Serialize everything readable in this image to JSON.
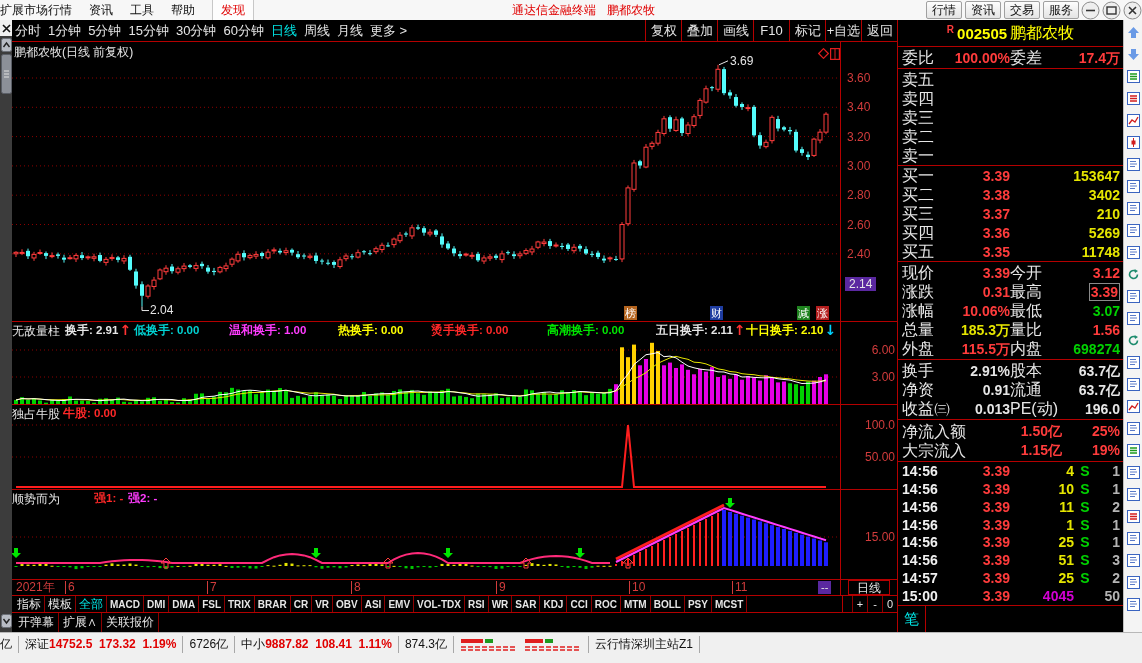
{
  "menu_bar": {
    "items": [
      {
        "label": "扩展市场行情",
        "highlighted": false
      },
      {
        "label": "资讯",
        "highlighted": false
      },
      {
        "label": "工具",
        "highlighted": false
      },
      {
        "label": "帮助",
        "highlighted": false
      },
      {
        "label": "发现",
        "highlighted": true
      }
    ],
    "title": "通达信金融终端",
    "security": "鹏都农牧",
    "buttons": [
      "行情",
      "资讯",
      "交易",
      "服务"
    ]
  },
  "period_tabs": [
    {
      "label": "分时",
      "selected": false
    },
    {
      "label": "1分钟",
      "selected": false
    },
    {
      "label": "5分钟",
      "selected": false
    },
    {
      "label": "15分钟",
      "selected": false
    },
    {
      "label": "30分钟",
      "selected": false
    },
    {
      "label": "60分钟",
      "selected": false
    },
    {
      "label": "日线",
      "selected": true
    },
    {
      "label": "周线",
      "selected": false
    },
    {
      "label": "月线",
      "selected": false
    },
    {
      "label": "更多 >",
      "selected": false
    }
  ],
  "chart_buttons": [
    "复权",
    "叠加",
    "画线",
    "F10",
    "标记",
    "+自选",
    "返回"
  ],
  "main_chart": {
    "title": "鹏都农牧(日线 前复权)",
    "price_axis": [
      "3.60",
      "3.40",
      "3.20",
      "3.00",
      "2.80",
      "2.60",
      "2.40"
    ],
    "cursor_price": "2.14",
    "high_label": "3.69",
    "low_label": "2.04",
    "event_markers": [
      {
        "label": "榜",
        "color": "#b4641e"
      },
      {
        "label": "财",
        "color": "#1e3ca0"
      },
      {
        "label": "减",
        "color": "#1e821e"
      },
      {
        "label": "涨",
        "color": "#b41e1e"
      }
    ]
  },
  "indicators": [
    {
      "name": "无敌量柱",
      "kind": "volume",
      "fields": [
        {
          "text": "换手: 2.91",
          "color": "#e6e6e6",
          "arrow": {
            "text": "↑",
            "color": "#ff3232"
          }
        },
        {
          "text": "低换手: 0.00",
          "color": "#00d2d2"
        },
        {
          "text": "温和换手: 1.00",
          "color": "#ff3cff"
        },
        {
          "text": "热换手: 0.00",
          "color": "#ffff00"
        },
        {
          "text": "烫手换手: 0.00",
          "color": "#ff2828"
        },
        {
          "text": "高潮换手: 0.00",
          "color": "#00e600"
        },
        {
          "text": "五日换手: 2.11",
          "color": "#e6e6e6",
          "arrow": {
            "text": "↑",
            "color": "#ff3232"
          }
        },
        {
          "text": "十日换手: 2.10",
          "color": "#ffff00",
          "arrow": {
            "text": "↓",
            "color": "#00d2ff"
          }
        }
      ],
      "axis": [
        "6.00",
        "3.00"
      ]
    },
    {
      "name": "独占牛股",
      "kind": "signal",
      "fields": [
        {
          "text": "牛股: 0.00",
          "color": "#ff2828"
        }
      ],
      "axis": [
        "100.0",
        "50.00"
      ]
    },
    {
      "name": "顺势而为",
      "kind": "trend",
      "fields": [
        {
          "text": "强1: -",
          "color": "#ff2828"
        },
        {
          "text": "强2: -",
          "color": "#ff3cff"
        }
      ],
      "axis": [
        "15.00"
      ]
    }
  ],
  "date_axis": {
    "year": "2021年",
    "months": [
      "6",
      "7",
      "8",
      "9",
      "10",
      "11"
    ],
    "cursor_date": "--",
    "period": "日线"
  },
  "indicator_tabs": [
    {
      "label": "指标",
      "selected": false
    },
    {
      "label": "模板",
      "selected": false
    },
    {
      "label": "全部",
      "selected": true
    },
    {
      "label": "MACD",
      "selected": false
    },
    {
      "label": "DMI",
      "selected": false
    },
    {
      "label": "DMA",
      "selected": false
    },
    {
      "label": "FSL",
      "selected": false
    },
    {
      "label": "TRIX",
      "selected": false
    },
    {
      "label": "BRAR",
      "selected": false
    },
    {
      "label": "CR",
      "selected": false
    },
    {
      "label": "VR",
      "selected": false
    },
    {
      "label": "OBV",
      "selected": false
    },
    {
      "label": "ASI",
      "selected": false
    },
    {
      "label": "EMV",
      "selected": false
    },
    {
      "label": "VOL-TDX",
      "selected": false
    },
    {
      "label": "RSI",
      "selected": false
    },
    {
      "label": "WR",
      "selected": false
    },
    {
      "label": "SAR",
      "selected": false
    },
    {
      "label": "KDJ",
      "selected": false
    },
    {
      "label": "CCI",
      "selected": false
    },
    {
      "label": "ROC",
      "selected": false
    },
    {
      "label": "MTM",
      "selected": false
    },
    {
      "label": "BOLL",
      "selected": false
    },
    {
      "label": "PSY",
      "selected": false
    },
    {
      "label": "MCST",
      "selected": false
    }
  ],
  "zoom_buttons": [
    "+",
    "-",
    "0"
  ],
  "bottom_tabs": [
    "开弹幕",
    "扩展∧",
    "关联报价"
  ],
  "quote": {
    "flag": "R",
    "code": "002505",
    "name": "鹏都农牧",
    "order_ratio": [
      {
        "label": "委比",
        "value": "100.00%"
      },
      {
        "label": "委差",
        "value": "17.4万"
      }
    ],
    "sell_levels": [
      "卖五",
      "卖四",
      "卖三",
      "卖二",
      "卖一"
    ],
    "buy_levels": [
      {
        "label": "买一",
        "price": "3.39",
        "volume": "153647"
      },
      {
        "label": "买二",
        "price": "3.38",
        "volume": "3402"
      },
      {
        "label": "买三",
        "price": "3.37",
        "volume": "210"
      },
      {
        "label": "买四",
        "price": "3.36",
        "volume": "5269"
      },
      {
        "label": "买五",
        "price": "3.35",
        "volume": "11748"
      }
    ],
    "stats": [
      [
        {
          "label": "现价",
          "value": "3.39",
          "color": "#ff3c3c",
          "boxed": false
        },
        {
          "label": "今开",
          "value": "3.12",
          "color": "#ff3c3c",
          "boxed": false
        }
      ],
      [
        {
          "label": "涨跌",
          "value": "0.31",
          "color": "#ff3c3c",
          "boxed": false
        },
        {
          "label": "最高",
          "value": "3.39",
          "color": "#ff3c3c",
          "boxed": true
        }
      ],
      [
        {
          "label": "涨幅",
          "value": "10.06%",
          "color": "#ff3c3c",
          "boxed": false
        },
        {
          "label": "最低",
          "value": "3.07",
          "color": "#00d200",
          "boxed": false
        }
      ],
      [
        {
          "label": "总量",
          "value": "185.3万",
          "color": "#e6e600",
          "boxed": false
        },
        {
          "label": "量比",
          "value": "1.56",
          "color": "#ff3c3c",
          "boxed": false
        }
      ],
      [
        {
          "label": "外盘",
          "value": "115.5万",
          "color": "#ff3c3c",
          "boxed": false
        },
        {
          "label": "内盘",
          "value": "698274",
          "color": "#00d200",
          "boxed": false
        }
      ]
    ],
    "fundamentals": [
      [
        {
          "label": "换手",
          "value": "2.91%"
        },
        {
          "label": "股本",
          "value": "63.7亿"
        }
      ],
      [
        {
          "label": "净资",
          "value": "0.91"
        },
        {
          "label": "流通",
          "value": "63.7亿"
        }
      ],
      [
        {
          "label": "收益㈢",
          "value": "0.013"
        },
        {
          "label": "PE(动)",
          "value": "196.0"
        }
      ]
    ],
    "flows": [
      {
        "label": "净流入额",
        "amount": "1.50亿",
        "ratio": "25%"
      },
      {
        "label": "大宗流入",
        "amount": "1.15亿",
        "ratio": "19%"
      }
    ],
    "ticks": [
      {
        "time": "14:56",
        "price": "3.39",
        "volume": "4",
        "side": "S",
        "count": "1",
        "color": "#e6e600"
      },
      {
        "time": "14:56",
        "price": "3.39",
        "volume": "10",
        "side": "S",
        "count": "1",
        "color": "#e6e600"
      },
      {
        "time": "14:56",
        "price": "3.39",
        "volume": "11",
        "side": "S",
        "count": "2",
        "color": "#e6e600"
      },
      {
        "time": "14:56",
        "price": "3.39",
        "volume": "1",
        "side": "S",
        "count": "1",
        "color": "#e6e600"
      },
      {
        "time": "14:56",
        "price": "3.39",
        "volume": "25",
        "side": "S",
        "count": "1",
        "color": "#e6e600"
      },
      {
        "time": "14:56",
        "price": "3.39",
        "volume": "51",
        "side": "S",
        "count": "3",
        "color": "#e6e600"
      },
      {
        "time": "14:57",
        "price": "3.39",
        "volume": "25",
        "side": "S",
        "count": "2",
        "color": "#e6e600"
      },
      {
        "time": "15:00",
        "price": "3.39",
        "volume": "4045",
        "count": "50",
        "color": "#d200d2"
      }
    ],
    "tick_tabs": [
      {
        "label": "笔",
        "selected": true
      }
    ]
  },
  "status_bar": {
    "leading": "亿",
    "indexes": [
      {
        "name": "深证",
        "value": "14752.5",
        "change": "173.32",
        "percent": "1.19%",
        "amount": "6726亿"
      },
      {
        "name": "中小",
        "value": "9887.82",
        "change": "108.41",
        "percent": "1.11%",
        "amount": "874.3亿"
      }
    ],
    "server": "云行情深圳主站Z1"
  }
}
